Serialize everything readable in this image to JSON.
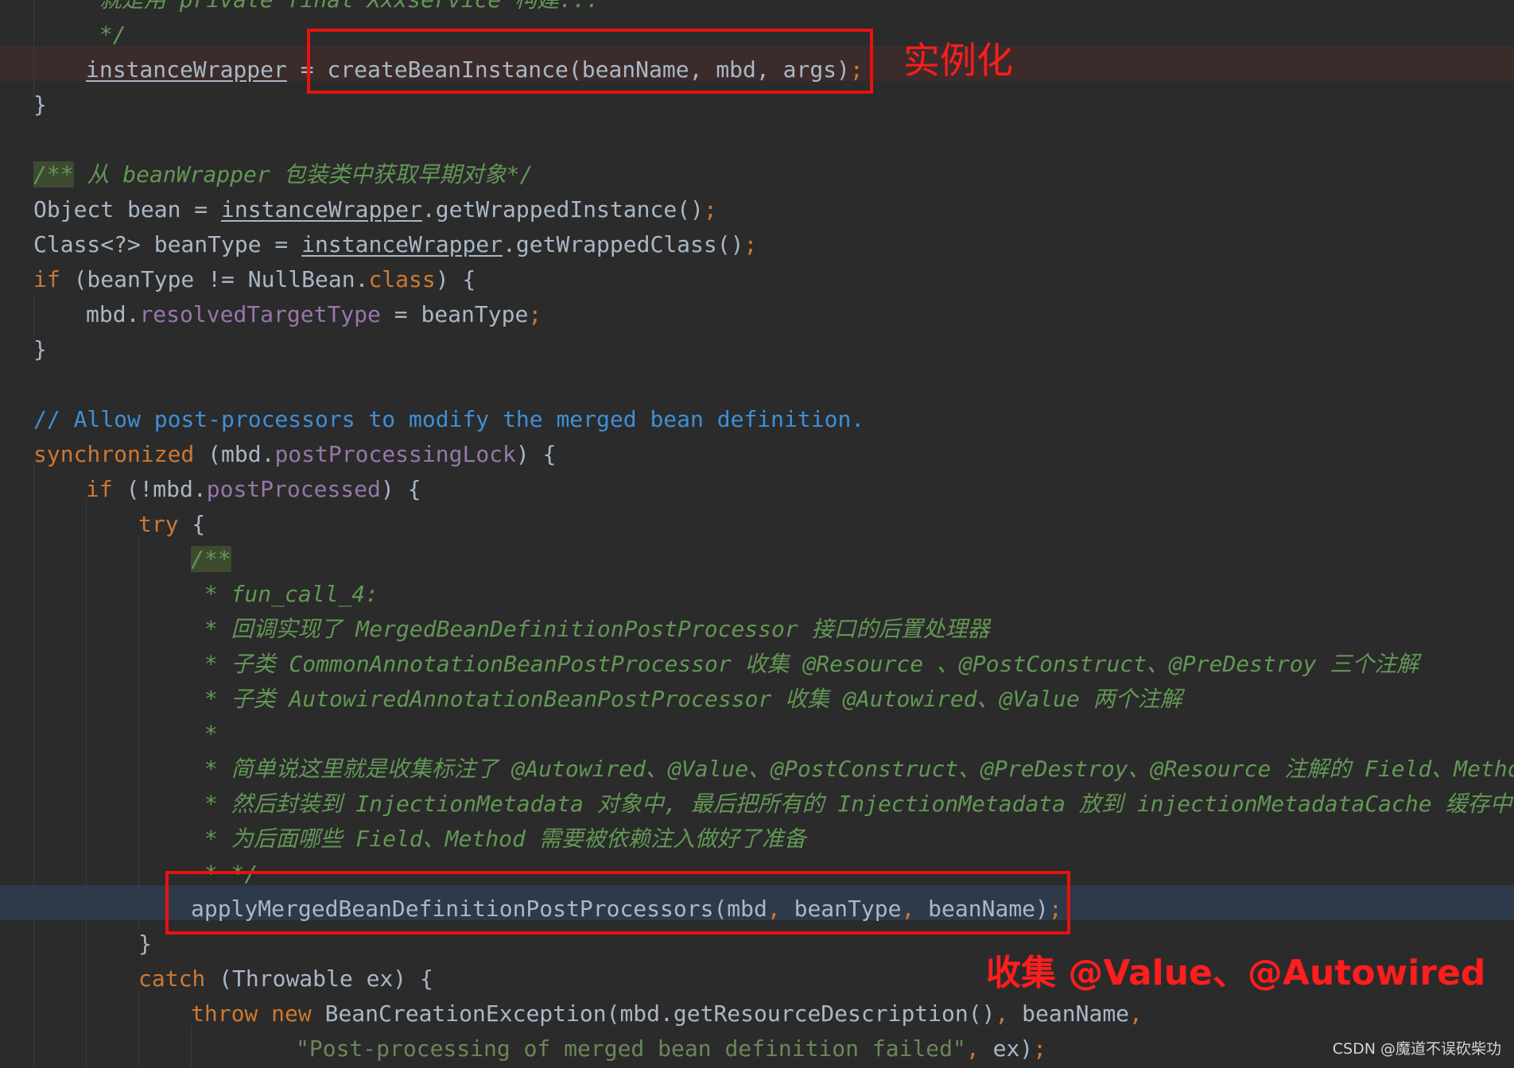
{
  "code_lines": [
    {
      "indent": 2,
      "tokens": [
        {
          "t": " 就是用 private final Xxxservice 构建...",
          "c": "t-doc"
        }
      ]
    },
    {
      "indent": 2,
      "tokens": [
        {
          "t": " */",
          "c": "t-doc"
        }
      ]
    },
    {
      "indent": 2,
      "tokens": [
        {
          "t": "instanceWrapper",
          "c": "t-var"
        },
        {
          "t": " = createBeanInstance(beanName, mbd, args)",
          "c": "t-plain"
        },
        {
          "t": ";",
          "c": "t-kw"
        }
      ]
    },
    {
      "indent": 1,
      "tokens": [
        {
          "t": "}",
          "c": "t-plain"
        }
      ]
    },
    {
      "indent": 1,
      "tokens": []
    },
    {
      "indent": 1,
      "tokens": [
        {
          "t": "/**",
          "c": "t-doc doc-bg"
        },
        {
          "t": " 从 beanWrapper 包装类中获取早期对象*/",
          "c": "t-doc"
        }
      ]
    },
    {
      "indent": 1,
      "tokens": [
        {
          "t": "Object bean = ",
          "c": "t-plain"
        },
        {
          "t": "instanceWrapper",
          "c": "t-var"
        },
        {
          "t": ".getWrappedInstance()",
          "c": "t-plain"
        },
        {
          "t": ";",
          "c": "t-kw"
        }
      ]
    },
    {
      "indent": 1,
      "tokens": [
        {
          "t": "Class<?> beanType = ",
          "c": "t-plain"
        },
        {
          "t": "instanceWrapper",
          "c": "t-var"
        },
        {
          "t": ".getWrappedClass()",
          "c": "t-plain"
        },
        {
          "t": ";",
          "c": "t-kw"
        }
      ]
    },
    {
      "indent": 1,
      "tokens": [
        {
          "t": "if",
          "c": "t-kw"
        },
        {
          "t": " (beanType != NullBean.",
          "c": "t-plain"
        },
        {
          "t": "class",
          "c": "t-kw"
        },
        {
          "t": ") {",
          "c": "t-plain"
        }
      ]
    },
    {
      "indent": 2,
      "tokens": [
        {
          "t": "mbd.",
          "c": "t-plain"
        },
        {
          "t": "resolvedTargetType",
          "c": "t-field"
        },
        {
          "t": " = beanType",
          "c": "t-plain"
        },
        {
          "t": ";",
          "c": "t-kw"
        }
      ]
    },
    {
      "indent": 1,
      "tokens": [
        {
          "t": "}",
          "c": "t-plain"
        }
      ]
    },
    {
      "indent": 1,
      "tokens": []
    },
    {
      "indent": 1,
      "tokens": [
        {
          "t": "// Allow post-processors to modify the merged bean definition.",
          "c": "t-linecomment"
        }
      ]
    },
    {
      "indent": 1,
      "tokens": [
        {
          "t": "synchronized",
          "c": "t-kw"
        },
        {
          "t": " (mbd.",
          "c": "t-plain"
        },
        {
          "t": "postProcessingLock",
          "c": "t-field"
        },
        {
          "t": ") {",
          "c": "t-plain"
        }
      ]
    },
    {
      "indent": 2,
      "tokens": [
        {
          "t": "if",
          "c": "t-kw"
        },
        {
          "t": " (!mbd.",
          "c": "t-plain"
        },
        {
          "t": "postProcessed",
          "c": "t-field"
        },
        {
          "t": ") {",
          "c": "t-plain"
        }
      ]
    },
    {
      "indent": 3,
      "tokens": [
        {
          "t": "try",
          "c": "t-kw"
        },
        {
          "t": " {",
          "c": "t-plain"
        }
      ]
    },
    {
      "indent": 4,
      "tokens": [
        {
          "t": "/**",
          "c": "t-doc doc-bg"
        }
      ]
    },
    {
      "indent": 4,
      "tokens": [
        {
          "t": " * fun_call_4:",
          "c": "t-doc"
        }
      ]
    },
    {
      "indent": 4,
      "tokens": [
        {
          "t": " * 回调实现了 MergedBeanDefinitionPostProcessor 接口的后置处理器",
          "c": "t-doc"
        }
      ]
    },
    {
      "indent": 4,
      "tokens": [
        {
          "t": " * 子类 CommonAnnotationBeanPostProcessor 收集 @Resource 、@PostConstruct、@PreDestroy 三个注解",
          "c": "t-doc"
        }
      ]
    },
    {
      "indent": 4,
      "tokens": [
        {
          "t": " * 子类 AutowiredAnnotationBeanPostProcessor 收集 @Autowired、@Value 两个注解",
          "c": "t-doc"
        }
      ]
    },
    {
      "indent": 4,
      "tokens": [
        {
          "t": " *",
          "c": "t-doc"
        }
      ]
    },
    {
      "indent": 4,
      "tokens": [
        {
          "t": " * 简单说这里就是收集标注了 @Autowired、@Value、@PostConstruct、@PreDestroy、@Resource 注解的 Field、Method",
          "c": "t-doc"
        }
      ]
    },
    {
      "indent": 4,
      "tokens": [
        {
          "t": " * 然后封装到 InjectionMetadata 对象中, 最后把所有的 InjectionMetadata 放到 injectionMetadataCache 缓存中",
          "c": "t-doc"
        }
      ]
    },
    {
      "indent": 4,
      "tokens": [
        {
          "t": " * 为后面哪些 Field、Method 需要被依赖注入做好了准备",
          "c": "t-doc"
        }
      ]
    },
    {
      "indent": 4,
      "tokens": [
        {
          "t": " * */",
          "c": "t-doc"
        }
      ]
    },
    {
      "indent": 4,
      "tokens": [
        {
          "t": "applyMergedBeanDefinitionPostProcessors(mbd",
          "c": "t-plain"
        },
        {
          "t": ",",
          "c": "t-kw"
        },
        {
          "t": " beanType",
          "c": "t-plain"
        },
        {
          "t": ",",
          "c": "t-kw"
        },
        {
          "t": " beanName)",
          "c": "t-plain"
        },
        {
          "t": ";",
          "c": "t-kw"
        }
      ]
    },
    {
      "indent": 3,
      "tokens": [
        {
          "t": "}",
          "c": "t-plain"
        }
      ]
    },
    {
      "indent": 3,
      "tokens": [
        {
          "t": "catch",
          "c": "t-kw"
        },
        {
          "t": " (Throwable ex) {",
          "c": "t-plain"
        }
      ]
    },
    {
      "indent": 4,
      "tokens": [
        {
          "t": "throw new",
          "c": "t-kw"
        },
        {
          "t": " BeanCreationException(mbd.getResourceDescription()",
          "c": "t-plain"
        },
        {
          "t": ",",
          "c": "t-kw"
        },
        {
          "t": " beanName",
          "c": "t-plain"
        },
        {
          "t": ",",
          "c": "t-kw"
        }
      ]
    },
    {
      "indent": 6,
      "tokens": [
        {
          "t": "\"Post-processing of merged bean definition failed\"",
          "c": "t-str"
        },
        {
          "t": ",",
          "c": "t-kw"
        },
        {
          "t": " ex)",
          "c": "t-plain"
        },
        {
          "t": ";",
          "c": "t-kw"
        }
      ]
    },
    {
      "indent": 3,
      "tokens": [
        {
          "t": "}",
          "c": "t-plain"
        }
      ]
    }
  ],
  "annotations": {
    "instantiate_label": "实例化",
    "collect_label": "收集 @Value、@Autowired"
  },
  "watermark": "CSDN @魔道不误砍柴功",
  "colors": {
    "background": "#2b2b2b",
    "keyword": "#cc7832",
    "field": "#9876aa",
    "doc_comment": "#629755",
    "line_comment": "#3f8fd6",
    "annotation_red": "#e8120f"
  }
}
